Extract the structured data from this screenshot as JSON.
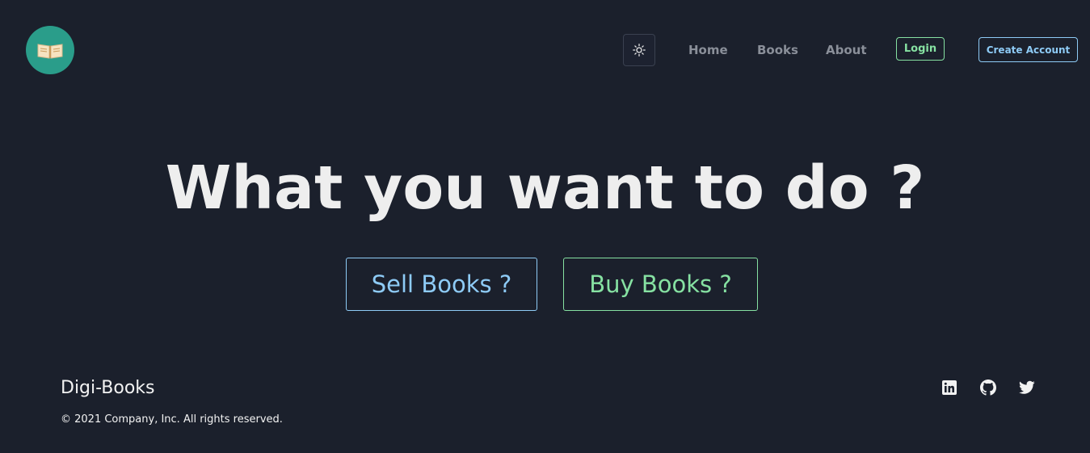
{
  "header": {
    "logo_icon": "open-book-icon",
    "theme_toggle_icon": "sun-icon",
    "nav": [
      {
        "label": "Home"
      },
      {
        "label": "Books"
      },
      {
        "label": "About"
      }
    ],
    "login_label": "Login",
    "create_account_label": "Create Account"
  },
  "hero": {
    "title": "What you want to do ?",
    "sell_label": "Sell Books ?",
    "buy_label": "Buy Books ?"
  },
  "footer": {
    "brand": "Digi-Books",
    "copyright": "© 2021 Company, Inc. All rights reserved.",
    "social": [
      "linkedin-icon",
      "github-icon",
      "twitter-icon"
    ]
  },
  "colors": {
    "background": "#1b202c",
    "accent_blue": "#8ecbf6",
    "accent_green": "#86e1a2",
    "logo_bg": "#2a9d8a",
    "text_primary": "#eeeeee",
    "nav_text": "#8a8f99"
  }
}
